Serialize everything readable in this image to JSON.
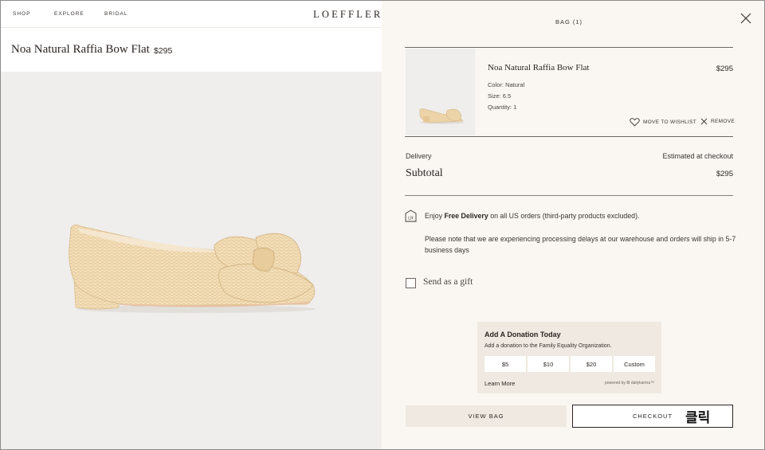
{
  "nav": {
    "links": [
      "SHOP",
      "EXPLORE",
      "BRIDAL"
    ],
    "logo": "LOEFFLER"
  },
  "product": {
    "title": "Noa Natural Raffia Bow Flat",
    "price": "$295"
  },
  "bag": {
    "title": "BAG (1)",
    "close_icon": "close-icon",
    "item": {
      "name": "Noa Natural Raffia Bow Flat",
      "price": "$295",
      "color": "Color: Natural",
      "size": "Size: 6.5",
      "quantity": "Quantity: 1",
      "wishlist_label": "MOVE TO WISHLIST",
      "wishlist_icon": "heart-icon",
      "remove_label": "REMOVE",
      "remove_icon": "x-icon"
    },
    "delivery_label": "Delivery",
    "delivery_value": "Estimated at checkout",
    "subtotal_label": "Subtotal",
    "subtotal_value": "$295",
    "promo_prefix": "Enjoy",
    "promo_bold": "Free Delivery",
    "promo_suffix": "on all US orders (third-party products excluded).",
    "promo_icon": "lr-box-icon",
    "promo_icon_text": "LR",
    "notice": "Please note that we are experiencing processing delays at our warehouse and orders will ship in 5-7 business days",
    "gift_label": "Send as a gift",
    "donation": {
      "title": "Add A Donation Today",
      "subtitle": "Add a donation to the Family Equality Organization.",
      "options": [
        "$5",
        "$10",
        "$20",
        "Custom"
      ],
      "learn_more": "Learn More",
      "powered_by": "powered by ❂ dailykarma™"
    },
    "view_bag_label": "VIEW BAG",
    "checkout_label": "CHECKOUT",
    "click_hint": "클릭"
  },
  "colors": {
    "drawer_bg": "#faf7f3",
    "accent_beige": "#efe9e1",
    "image_bg": "#efeeec",
    "text_dark": "#2b2522"
  }
}
